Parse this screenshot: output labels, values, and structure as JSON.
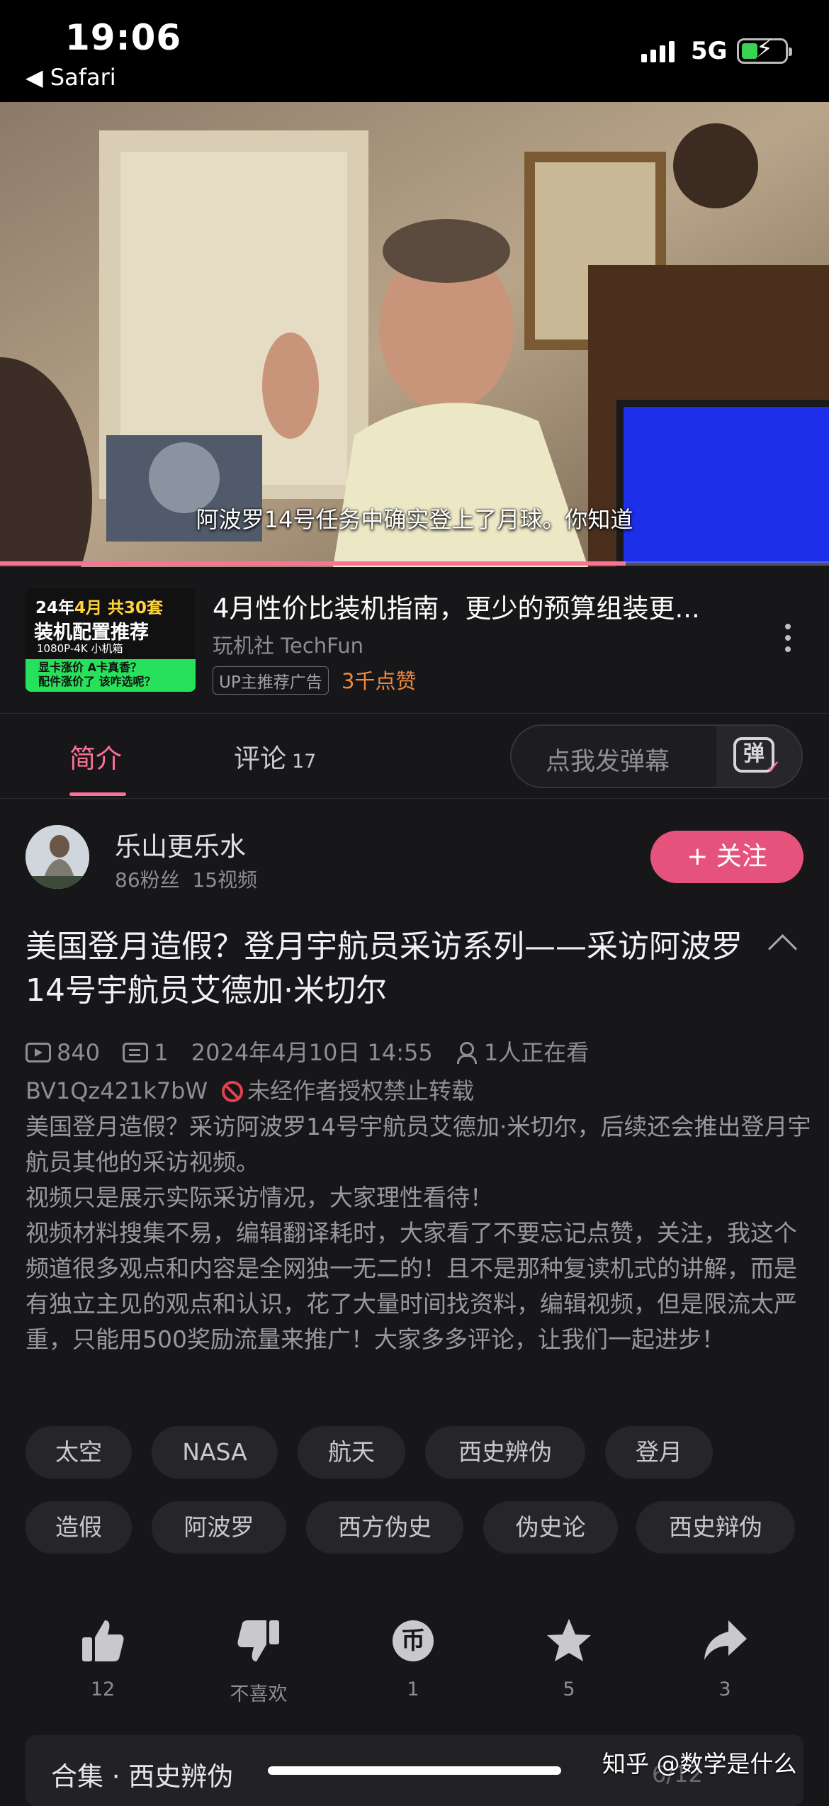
{
  "status_bar": {
    "time": "19:06",
    "back_app": "◀ Safari",
    "network": "5G"
  },
  "video": {
    "subtitle": "阿波罗14号任务中确实登上了月球。你知道",
    "progress": 0.755
  },
  "ad": {
    "thumb_line1_a": "24年",
    "thumb_line1_b": "4月",
    "thumb_line1_c": " 共30套",
    "thumb_line2": "装机配置推荐",
    "thumb_line3": "1080P-4K    小机箱",
    "thumb_line4": "显卡涨价 A卡真香？\n配件涨价了 该咋选呢？",
    "title": "4月性价比装机指南，更少的预算组装更...",
    "channel": "玩机社 TechFun",
    "tag": "UP主推荐广告",
    "likes": "3千点赞"
  },
  "tabs": {
    "intro": "简介",
    "comments": "评论",
    "comments_count": "17",
    "danmaku_placeholder": "点我发弹幕",
    "danmaku_icon": "弹"
  },
  "uploader": {
    "name": "乐山更乐水",
    "stats": "86粉丝  15视频",
    "follow_label": "+ 关注"
  },
  "video_info": {
    "title": "美国登月造假？登月宇航员采访系列——采访阿波罗14号宇航员艾德加·米切尔",
    "views": "840",
    "danmaku_count": "1",
    "date": "2024年4月10日 14:55",
    "watching": "1人正在看",
    "bvid": "BV1Qz421k7bW",
    "notice": "未经作者授权禁止转载",
    "description": [
      "美国登月造假？采访阿波罗14号宇航员艾德加·米切尔，后续还会推出登月宇航员其他的采访视频。",
      "视频只是展示实际采访情况，大家理性看待！",
      "视频材料搜集不易，编辑翻译耗时，大家看了不要忘记点赞，关注，我这个频道很多观点和内容是全网独一无二的！且不是那种复读机式的讲解，而是有独立主见的观点和认识，花了大量时间找资料，编辑视频，但是限流太严重，只能用500奖励流量来推广！大家多多评论，让我们一起进步！"
    ]
  },
  "tags": [
    "太空",
    "NASA",
    "航天",
    "西史辨伪",
    "登月",
    "造假",
    "阿波罗",
    "西方伪史",
    "伪史论",
    "西史辩伪"
  ],
  "actions": {
    "like": "12",
    "dislike": "不喜欢",
    "coin": "1",
    "coin_glyph": "币",
    "favorite": "5",
    "share": "3"
  },
  "collection": {
    "name": "合集 · 西史辨伪",
    "page": "6/12"
  },
  "watermark": "知乎 @数学是什么",
  "colors": {
    "accent": "#fb7299",
    "follow": "#e5537c",
    "ad_likes": "#f08a3e",
    "background": "#17171a"
  }
}
